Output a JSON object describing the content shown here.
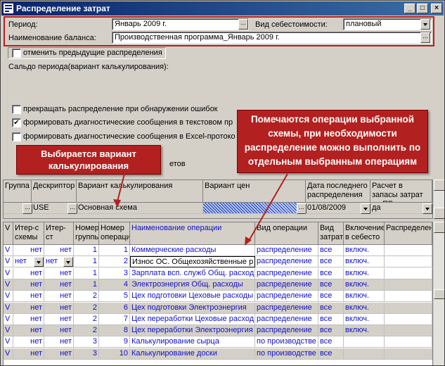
{
  "window": {
    "title": "Распределение затрат",
    "minimize": "_",
    "maximize": "□",
    "close": "×"
  },
  "header": {
    "period_label": "Период:",
    "period_value": "Январь 2009 г.",
    "cost_type_label": "Вид себестоимости:",
    "cost_type_value": "плановый",
    "balance_label": "Наименование баланса:",
    "balance_value": "Производственная программа_Январь 2009 г.",
    "ellipsis": "..."
  },
  "options": {
    "cancel_prev": "отменить предыдущие распределения",
    "saldo_label": "Сальдо периода(вариант калькулирования):",
    "stop_on_error": "прекращать распределение при обнаружении ошибок",
    "diag_text": "формировать диагностические сообщения в текстовом пр",
    "diag_excel": "формировать диагностические сообщения в Excel-протоко",
    "hidden_tail": "етов",
    "check_mark": "✔"
  },
  "callouts": {
    "variant": "Выбирается вариант калькулирования",
    "operations": "Помечаются операции выбранной схемы, при необходимости распределение можно выполнить по отдельным выбранным операциям"
  },
  "top_grid": {
    "headers": [
      "Группа",
      "Дескриптор",
      "Вариант калькулирования",
      "Вариант цен",
      "Дата последнего распределения",
      "Расчет в запасы затрат по ПВ"
    ],
    "row": {
      "descriptor": "USE",
      "variant": "Основная схема",
      "date": "01/08/2009",
      "calc": "да"
    }
  },
  "ops_grid": {
    "headers": [
      "V",
      "Итер-с схемы",
      "Итер-ст группы",
      "Номер группы",
      "Номер операции",
      "Наименование операции",
      "Вид операции",
      "Вид затрат",
      "Включение в себесто",
      "Распределен"
    ],
    "rows": [
      {
        "v": "V",
        "it1": "нет",
        "it2": "нет",
        "grp": "1",
        "op": "1",
        "name": "Коммерческие расходы",
        "kind": "распределение",
        "cost": "все",
        "incl": "включ."
      },
      {
        "v": "V",
        "it1": "нет",
        "it2": "нет",
        "grp": "1",
        "op": "2",
        "name": "Износ ОС. Общехозяйственные р",
        "kind": "распределение",
        "cost": "все",
        "incl": "включ."
      },
      {
        "v": "V",
        "it1": "нет",
        "it2": "нет",
        "grp": "1",
        "op": "3",
        "name": "Зарплата всп. служб Общ. расход",
        "kind": "распределение",
        "cost": "все",
        "incl": "включ."
      },
      {
        "v": "V",
        "it1": "нет",
        "it2": "нет",
        "grp": "1",
        "op": "4",
        "name": "Электроэнергия Общ. расходы",
        "kind": "распределение",
        "cost": "все",
        "incl": "включ."
      },
      {
        "v": "V",
        "it1": "нет",
        "it2": "нет",
        "grp": "2",
        "op": "5",
        "name": "Цех подготовки Цеховые расходы",
        "kind": "распределение",
        "cost": "все",
        "incl": "включ."
      },
      {
        "v": "V",
        "it1": "нет",
        "it2": "нет",
        "grp": "2",
        "op": "6",
        "name": "Цех подготовки Электроэнергия",
        "kind": "распределение",
        "cost": "все",
        "incl": "включ."
      },
      {
        "v": "V",
        "it1": "нет",
        "it2": "нет",
        "grp": "2",
        "op": "7",
        "name": "Цех переработки Цеховые расход",
        "kind": "распределение",
        "cost": "все",
        "incl": "включ."
      },
      {
        "v": "V",
        "it1": "нет",
        "it2": "нет",
        "grp": "2",
        "op": "8",
        "name": "Цех переработки Электроэнергия",
        "kind": "распределение",
        "cost": "все",
        "incl": "включ."
      },
      {
        "v": "V",
        "it1": "нет",
        "it2": "нет",
        "grp": "3",
        "op": "9",
        "name": "Калькулирование сырца",
        "kind": "по производстве",
        "cost": "все",
        "incl": ""
      },
      {
        "v": "V",
        "it1": "нет",
        "it2": "нет",
        "grp": "3",
        "op": "10",
        "name": "Калькулирование доски",
        "kind": "по производстве",
        "cost": "все",
        "incl": ""
      }
    ]
  }
}
